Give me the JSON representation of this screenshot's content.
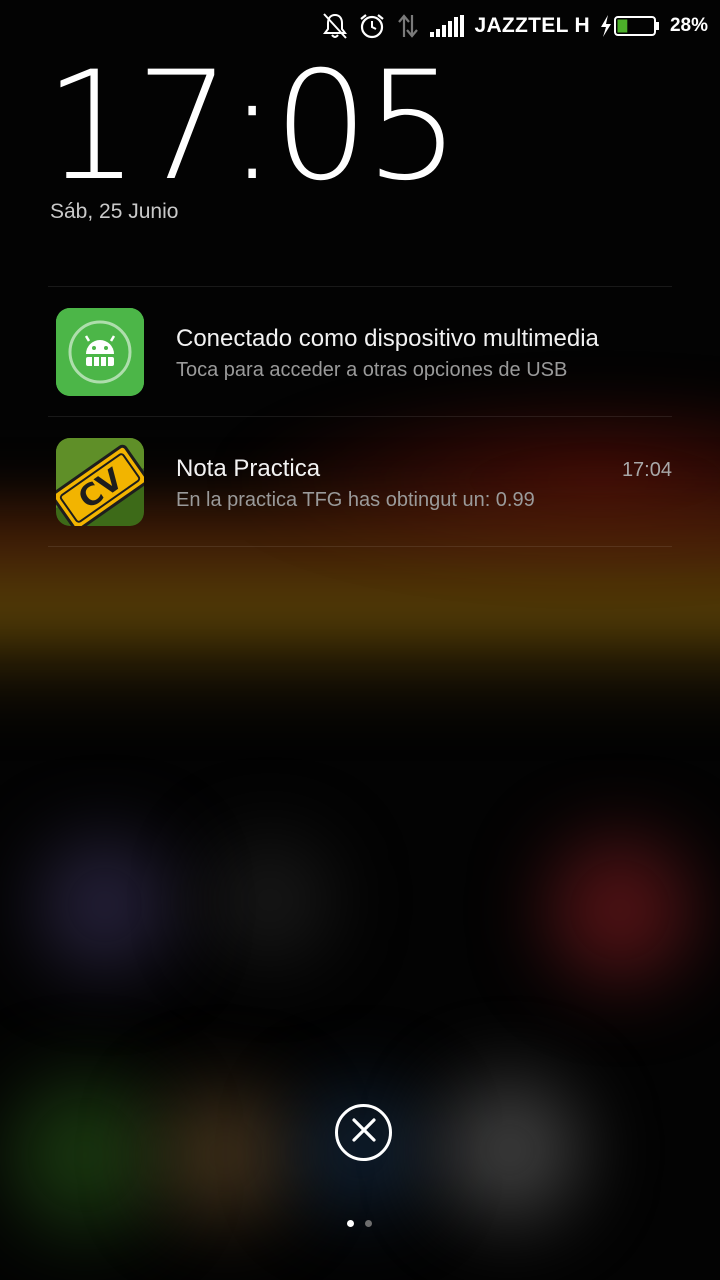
{
  "status_bar": {
    "icons": [
      "muted-bell-icon",
      "alarm-clock-icon",
      "data-arrows-icon",
      "signal-icon",
      "charging-bolt-icon",
      "battery-icon"
    ],
    "carrier": "JAZZTEL",
    "network_type": "H",
    "battery_percent": "28%",
    "battery_level": 0.28,
    "battery_color": "#4caf2a"
  },
  "lockscreen": {
    "time": "17:05",
    "date": "Sáb, 25 Junio"
  },
  "notifications": [
    {
      "icon": "android-usb-icon",
      "icon_color": "#4cb648",
      "title": "Conectado como dispositivo multimedia",
      "text": "Toca para acceder a otras opciones de USB",
      "time": ""
    },
    {
      "icon": "cv-app-icon",
      "icon_color": "#f2b400",
      "title": "Nota Practica",
      "text": "En la practica TFG has obtingut un: 0.99",
      "time": "17:04"
    }
  ],
  "controls": {
    "close_icon": "close-icon",
    "pages": 2,
    "active_page": 1
  }
}
